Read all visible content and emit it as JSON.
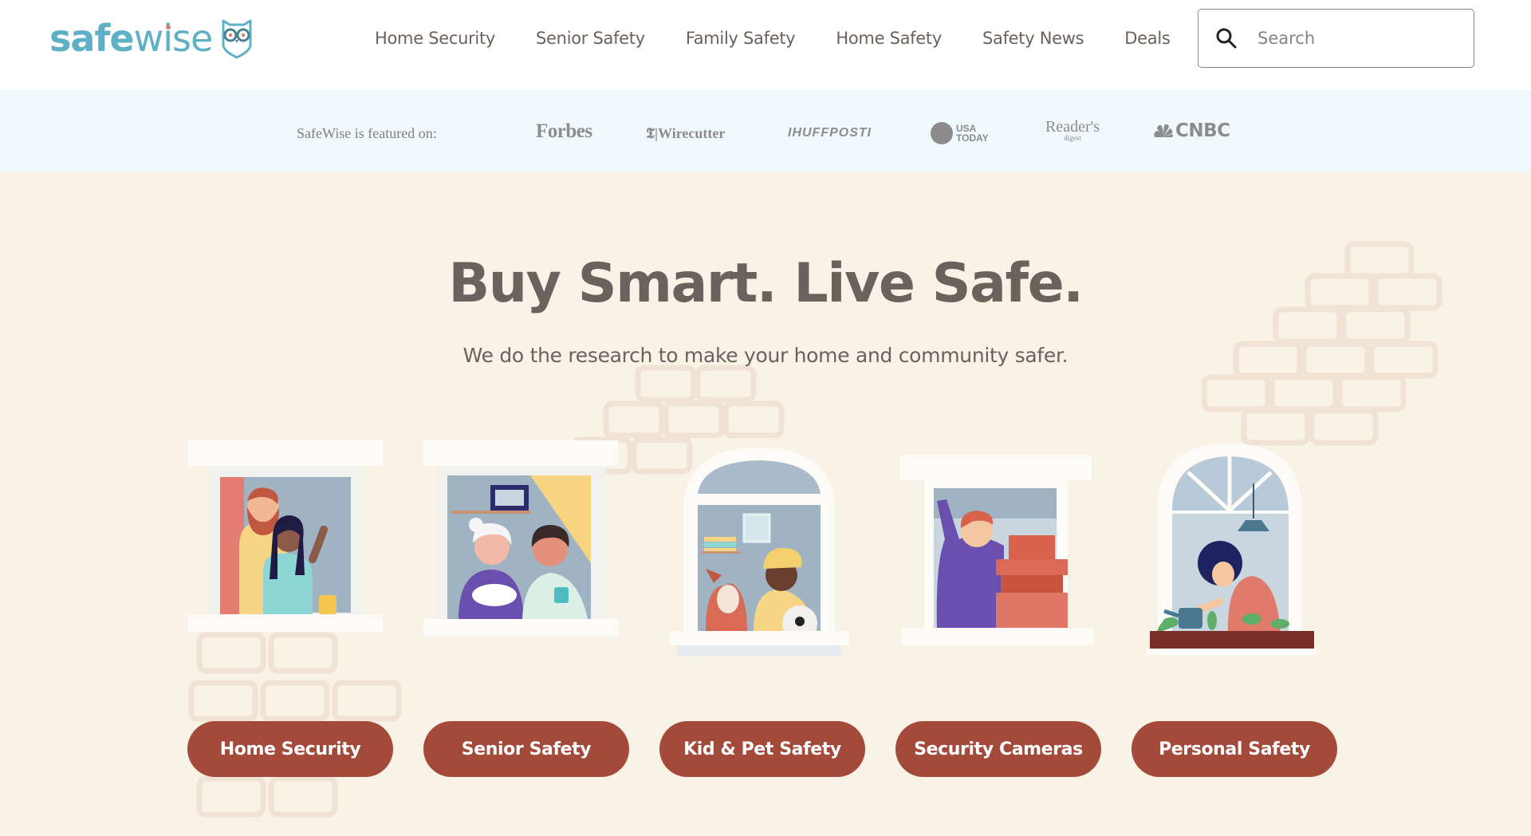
{
  "header": {
    "logo": {
      "text_bold": "safe",
      "text_light": "wise",
      "icon": "owl-icon"
    },
    "nav": [
      {
        "label": "Home Security"
      },
      {
        "label": "Senior Safety"
      },
      {
        "label": "Family Safety"
      },
      {
        "label": "Home Safety"
      },
      {
        "label": "Safety News"
      },
      {
        "label": "Deals"
      }
    ],
    "search": {
      "placeholder": "Search",
      "value": "",
      "icon": "search-icon"
    }
  },
  "featured": {
    "label": "SafeWise is featured on:",
    "outlets": [
      {
        "name": "Forbes"
      },
      {
        "name": "Wirecutter",
        "prefix": "𝕿|"
      },
      {
        "name": "HUFFPOST",
        "display": "IHUFFPOSTI"
      },
      {
        "name": "USA TODAY",
        "line1": "USA",
        "line2": "TODAY"
      },
      {
        "name": "Reader's Digest",
        "line1": "Reader's",
        "line2": "digest"
      },
      {
        "name": "CNBC"
      }
    ]
  },
  "hero": {
    "title": "Buy Smart. Live Safe.",
    "subtitle": "We do the research to make your home and community safer.",
    "categories": [
      {
        "label": "Home Security",
        "illustration": "couple-waving-window"
      },
      {
        "label": "Senior Safety",
        "illustration": "senior-with-cat-window"
      },
      {
        "label": "Kid & Pet Safety",
        "illustration": "kid-with-dog-window"
      },
      {
        "label": "Security Cameras",
        "illustration": "man-with-boxes-window"
      },
      {
        "label": "Personal Safety",
        "illustration": "woman-watering-plants-window"
      }
    ]
  },
  "colors": {
    "brand_blue": "#5eb0c6",
    "accent_red": "#a34a3b",
    "text_gray": "#6b615d",
    "hero_bg": "#f9f2e7",
    "featured_bg": "#eff8fb"
  }
}
